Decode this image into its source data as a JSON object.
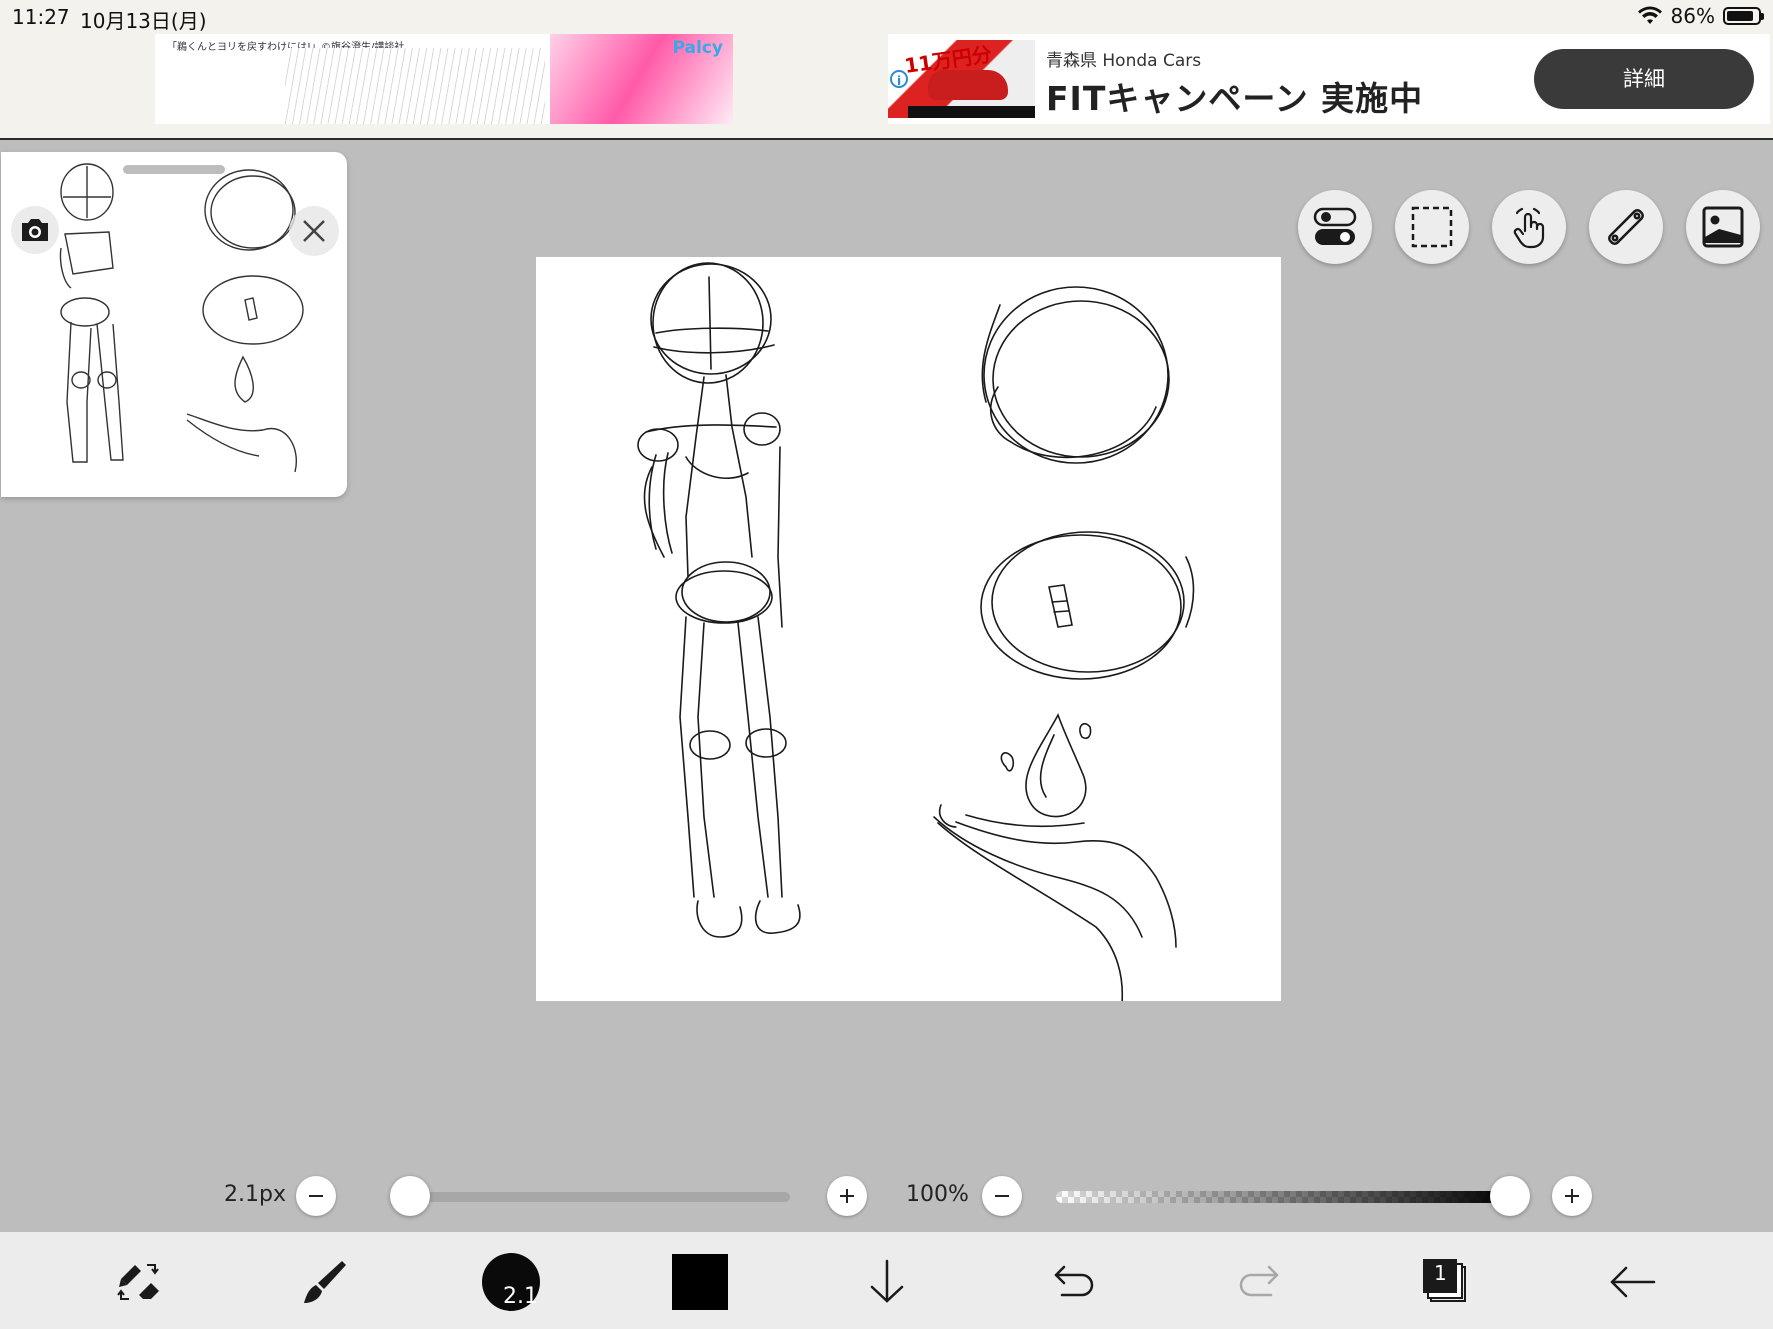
{
  "status_bar": {
    "time": "11:27",
    "date": "10月13日(月)",
    "battery": "86%",
    "battery_level": 0.86
  },
  "ad_left": {
    "caption": "「鵜くんとヨリを戻すわけには!」©旗谷澄生/講談社",
    "brand": "Palcy"
  },
  "ad_right": {
    "thumb_text": "11万円分",
    "advertiser": "青森県 Honda Cars",
    "headline": "FITキャンペーン 実施中",
    "cta": "詳細"
  },
  "reference_panel": {
    "camera_icon": "camera-icon",
    "close_icon": "close-icon"
  },
  "top_tools": [
    {
      "name": "toggle-icon"
    },
    {
      "name": "selection-icon"
    },
    {
      "name": "hand-icon"
    },
    {
      "name": "ruler-icon"
    },
    {
      "name": "image-icon"
    }
  ],
  "brush_size": {
    "label": "2.1px",
    "value_fraction": 0.05
  },
  "opacity": {
    "label": "100%",
    "value_fraction": 1.0
  },
  "bottom_toolbar": {
    "brush_preview_label": "2.1",
    "layer_count": "1",
    "current_color": "#000000"
  },
  "colors": {
    "background": "#bdbdbd",
    "canvas": "#ffffff",
    "cta": "#3a3a3a"
  }
}
